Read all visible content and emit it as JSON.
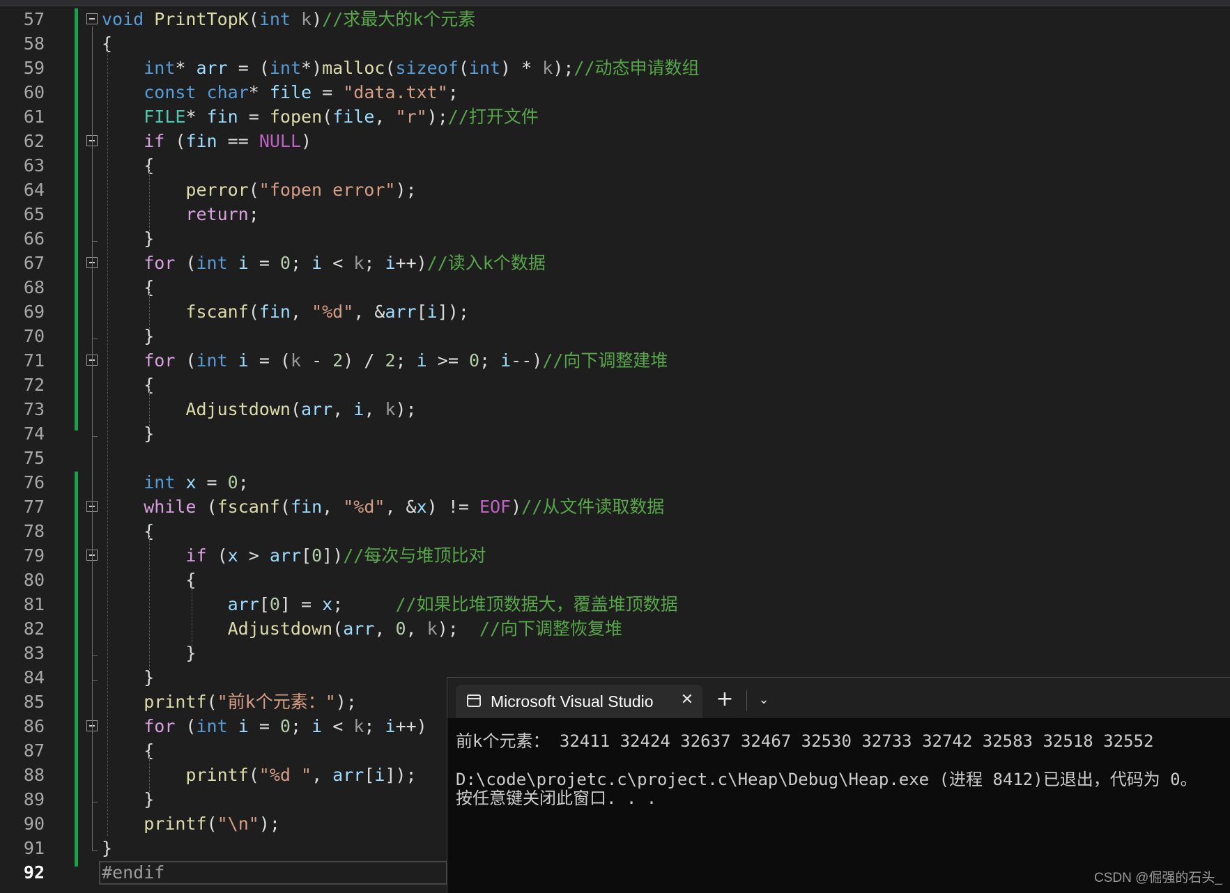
{
  "gutter": {
    "line_numbers": [
      "57",
      "58",
      "59",
      "60",
      "61",
      "62",
      "63",
      "64",
      "65",
      "66",
      "67",
      "68",
      "69",
      "70",
      "71",
      "72",
      "73",
      "74",
      "75",
      "76",
      "77",
      "78",
      "79",
      "80",
      "81",
      "82",
      "83",
      "84",
      "85",
      "86",
      "87",
      "88",
      "89",
      "90",
      "91",
      "92"
    ],
    "active_line": "92"
  },
  "code_lines": [
    [
      [
        "kw",
        "void"
      ],
      [
        "op",
        " "
      ],
      [
        "fn",
        "PrintTopK"
      ],
      [
        "op",
        "("
      ],
      [
        "kw",
        "int"
      ],
      [
        "op",
        " "
      ],
      [
        "par",
        "k"
      ],
      [
        "op",
        ")"
      ],
      [
        "cmt",
        "//求最大的k个元素"
      ]
    ],
    [
      [
        "op",
        "{"
      ]
    ],
    [
      [
        "op",
        "    "
      ],
      [
        "kw",
        "int"
      ],
      [
        "op",
        "* "
      ],
      [
        "id",
        "arr"
      ],
      [
        "op",
        " = ("
      ],
      [
        "kw",
        "int"
      ],
      [
        "op",
        "*)"
      ],
      [
        "fn",
        "malloc"
      ],
      [
        "op",
        "("
      ],
      [
        "kw",
        "sizeof"
      ],
      [
        "op",
        "("
      ],
      [
        "kw",
        "int"
      ],
      [
        "op",
        ") * "
      ],
      [
        "par",
        "k"
      ],
      [
        "op",
        ");"
      ],
      [
        "cmt",
        "//动态申请数组"
      ]
    ],
    [
      [
        "op",
        "    "
      ],
      [
        "kw",
        "const"
      ],
      [
        "op",
        " "
      ],
      [
        "kw",
        "char"
      ],
      [
        "op",
        "* "
      ],
      [
        "id",
        "file"
      ],
      [
        "op",
        " = "
      ],
      [
        "str",
        "\"data.txt\""
      ],
      [
        "op",
        ";"
      ]
    ],
    [
      [
        "op",
        "    "
      ],
      [
        "ty",
        "FILE"
      ],
      [
        "op",
        "* "
      ],
      [
        "id",
        "fin"
      ],
      [
        "op",
        " = "
      ],
      [
        "fn",
        "fopen"
      ],
      [
        "op",
        "("
      ],
      [
        "id",
        "file"
      ],
      [
        "op",
        ", "
      ],
      [
        "str",
        "\"r\""
      ],
      [
        "op",
        ");"
      ],
      [
        "cmt",
        "//打开文件"
      ]
    ],
    [
      [
        "op",
        "    "
      ],
      [
        "ctl",
        "if"
      ],
      [
        "op",
        " ("
      ],
      [
        "id",
        "fin"
      ],
      [
        "op",
        " == "
      ],
      [
        "mac",
        "NULL"
      ],
      [
        "op",
        ")"
      ]
    ],
    [
      [
        "op",
        "    {"
      ]
    ],
    [
      [
        "op",
        "        "
      ],
      [
        "fn",
        "perror"
      ],
      [
        "op",
        "("
      ],
      [
        "str",
        "\"fopen error\""
      ],
      [
        "op",
        ");"
      ]
    ],
    [
      [
        "op",
        "        "
      ],
      [
        "ctl",
        "return"
      ],
      [
        "op",
        ";"
      ]
    ],
    [
      [
        "op",
        "    }"
      ]
    ],
    [
      [
        "op",
        "    "
      ],
      [
        "ctl",
        "for"
      ],
      [
        "op",
        " ("
      ],
      [
        "kw",
        "int"
      ],
      [
        "op",
        " "
      ],
      [
        "id",
        "i"
      ],
      [
        "op",
        " = "
      ],
      [
        "num",
        "0"
      ],
      [
        "op",
        "; "
      ],
      [
        "id",
        "i"
      ],
      [
        "op",
        " < "
      ],
      [
        "par",
        "k"
      ],
      [
        "op",
        "; "
      ],
      [
        "id",
        "i"
      ],
      [
        "op",
        "++)"
      ],
      [
        "cmt",
        "//读入k个数据"
      ]
    ],
    [
      [
        "op",
        "    {"
      ]
    ],
    [
      [
        "op",
        "        "
      ],
      [
        "fn",
        "fscanf"
      ],
      [
        "op",
        "("
      ],
      [
        "id",
        "fin"
      ],
      [
        "op",
        ", "
      ],
      [
        "str",
        "\"%d\""
      ],
      [
        "op",
        ", &"
      ],
      [
        "id",
        "arr"
      ],
      [
        "op",
        "["
      ],
      [
        "id",
        "i"
      ],
      [
        "op",
        "]);"
      ]
    ],
    [
      [
        "op",
        "    }"
      ]
    ],
    [
      [
        "op",
        "    "
      ],
      [
        "ctl",
        "for"
      ],
      [
        "op",
        " ("
      ],
      [
        "kw",
        "int"
      ],
      [
        "op",
        " "
      ],
      [
        "id",
        "i"
      ],
      [
        "op",
        " = ("
      ],
      [
        "par",
        "k"
      ],
      [
        "op",
        " - "
      ],
      [
        "num",
        "2"
      ],
      [
        "op",
        ") / "
      ],
      [
        "num",
        "2"
      ],
      [
        "op",
        "; "
      ],
      [
        "id",
        "i"
      ],
      [
        "op",
        " >= "
      ],
      [
        "num",
        "0"
      ],
      [
        "op",
        "; "
      ],
      [
        "id",
        "i"
      ],
      [
        "op",
        "--)"
      ],
      [
        "cmt",
        "//向下调整建堆"
      ]
    ],
    [
      [
        "op",
        "    {"
      ]
    ],
    [
      [
        "op",
        "        "
      ],
      [
        "fn",
        "Adjustdown"
      ],
      [
        "op",
        "("
      ],
      [
        "id",
        "arr"
      ],
      [
        "op",
        ", "
      ],
      [
        "id",
        "i"
      ],
      [
        "op",
        ", "
      ],
      [
        "par",
        "k"
      ],
      [
        "op",
        ");"
      ]
    ],
    [
      [
        "op",
        "    }"
      ]
    ],
    [
      [
        "op",
        ""
      ]
    ],
    [
      [
        "op",
        "    "
      ],
      [
        "kw",
        "int"
      ],
      [
        "op",
        " "
      ],
      [
        "id",
        "x"
      ],
      [
        "op",
        " = "
      ],
      [
        "num",
        "0"
      ],
      [
        "op",
        ";"
      ]
    ],
    [
      [
        "op",
        "    "
      ],
      [
        "ctl",
        "while"
      ],
      [
        "op",
        " ("
      ],
      [
        "fn",
        "fscanf"
      ],
      [
        "op",
        "("
      ],
      [
        "id",
        "fin"
      ],
      [
        "op",
        ", "
      ],
      [
        "str",
        "\"%d\""
      ],
      [
        "op",
        ", &"
      ],
      [
        "id",
        "x"
      ],
      [
        "op",
        ") != "
      ],
      [
        "mac",
        "EOF"
      ],
      [
        "op",
        ")"
      ],
      [
        "cmt",
        "//从文件读取数据"
      ]
    ],
    [
      [
        "op",
        "    {"
      ]
    ],
    [
      [
        "op",
        "        "
      ],
      [
        "ctl",
        "if"
      ],
      [
        "op",
        " ("
      ],
      [
        "id",
        "x"
      ],
      [
        "op",
        " > "
      ],
      [
        "id",
        "arr"
      ],
      [
        "op",
        "["
      ],
      [
        "num",
        "0"
      ],
      [
        "op",
        "])"
      ],
      [
        "cmt",
        "//每次与堆顶比对"
      ]
    ],
    [
      [
        "op",
        "        {"
      ]
    ],
    [
      [
        "op",
        "            "
      ],
      [
        "id",
        "arr"
      ],
      [
        "op",
        "["
      ],
      [
        "num",
        "0"
      ],
      [
        "op",
        "] = "
      ],
      [
        "id",
        "x"
      ],
      [
        "op",
        ";     "
      ],
      [
        "cmt",
        "//如果比堆顶数据大，覆盖堆顶数据"
      ]
    ],
    [
      [
        "op",
        "            "
      ],
      [
        "fn",
        "Adjustdown"
      ],
      [
        "op",
        "("
      ],
      [
        "id",
        "arr"
      ],
      [
        "op",
        ", "
      ],
      [
        "num",
        "0"
      ],
      [
        "op",
        ", "
      ],
      [
        "par",
        "k"
      ],
      [
        "op",
        ");  "
      ],
      [
        "cmt",
        "//向下调整恢复堆"
      ]
    ],
    [
      [
        "op",
        "        }"
      ]
    ],
    [
      [
        "op",
        "    }"
      ]
    ],
    [
      [
        "op",
        "    "
      ],
      [
        "fn",
        "printf"
      ],
      [
        "op",
        "("
      ],
      [
        "str",
        "\"前k个元素：\""
      ],
      [
        "op",
        ");"
      ]
    ],
    [
      [
        "op",
        "    "
      ],
      [
        "ctl",
        "for"
      ],
      [
        "op",
        " ("
      ],
      [
        "kw",
        "int"
      ],
      [
        "op",
        " "
      ],
      [
        "id",
        "i"
      ],
      [
        "op",
        " = "
      ],
      [
        "num",
        "0"
      ],
      [
        "op",
        "; "
      ],
      [
        "id",
        "i"
      ],
      [
        "op",
        " < "
      ],
      [
        "par",
        "k"
      ],
      [
        "op",
        "; "
      ],
      [
        "id",
        "i"
      ],
      [
        "op",
        "++)"
      ]
    ],
    [
      [
        "op",
        "    {"
      ]
    ],
    [
      [
        "op",
        "        "
      ],
      [
        "fn",
        "printf"
      ],
      [
        "op",
        "("
      ],
      [
        "str",
        "\"%d \""
      ],
      [
        "op",
        ", "
      ],
      [
        "id",
        "arr"
      ],
      [
        "op",
        "["
      ],
      [
        "id",
        "i"
      ],
      [
        "op",
        "]);"
      ]
    ],
    [
      [
        "op",
        "    }"
      ]
    ],
    [
      [
        "op",
        "    "
      ],
      [
        "fn",
        "printf"
      ],
      [
        "op",
        "("
      ],
      [
        "str",
        "\"\\n\""
      ],
      [
        "op",
        ");"
      ]
    ],
    [
      [
        "op",
        "}"
      ]
    ],
    [
      [
        "pre",
        "#endif"
      ]
    ]
  ],
  "console": {
    "tab_title": "Microsoft Visual Studio",
    "close_glyph": "✕",
    "new_tab_glyph": "+",
    "dropdown_glyph": "⌄",
    "output_lines": [
      "前k个元素： 32411 32424 32637 32467 32530 32733 32742 32583 32518 32552",
      "",
      "D:\\code\\projetc.c\\project.c\\Heap\\Debug\\Heap.exe (进程 8412)已退出，代码为 0。",
      "按任意键关闭此窗口. . ."
    ]
  },
  "watermark": "CSDN @倔强的石头_"
}
